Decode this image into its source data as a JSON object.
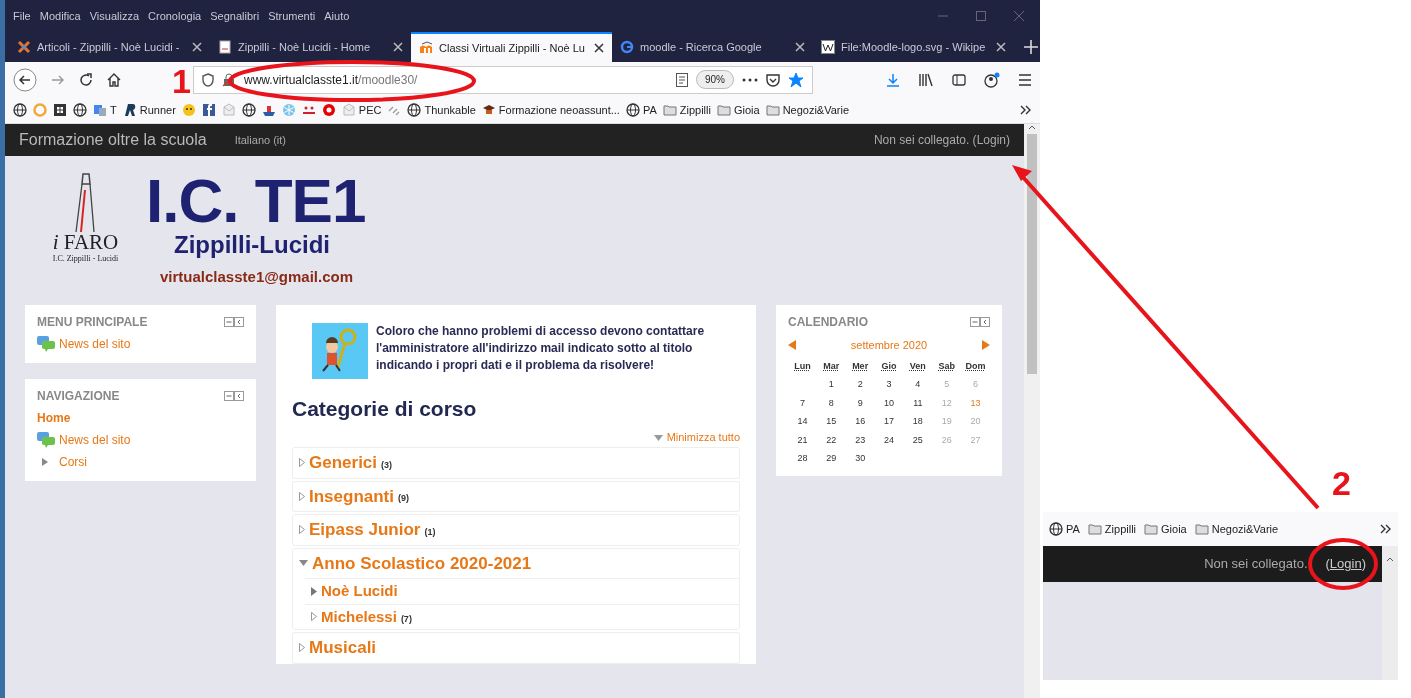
{
  "menu_bar": [
    "File",
    "Modifica",
    "Visualizza",
    "Cronologia",
    "Segnalibri",
    "Strumenti",
    "Aiuto"
  ],
  "tabs": [
    {
      "label": "Articoli - Zippilli - Noè Lucidi -",
      "kind": "joomla",
      "selected": false
    },
    {
      "label": "Zippilli - Noè Lucidi - Home",
      "kind": "page",
      "selected": false
    },
    {
      "label": "Classi Virtuali Zippilli - Noè Lu",
      "kind": "moodle",
      "selected": true
    },
    {
      "label": "moodle - Ricerca Google",
      "kind": "google",
      "selected": false
    },
    {
      "label": "File:Moodle-logo.svg - Wikipe",
      "kind": "wiki",
      "selected": false
    }
  ],
  "address_bar": {
    "host": "www.virtualclasste1.it",
    "path": "/moodle30/",
    "zoom": "90%",
    "bookmarked": true
  },
  "bookmarks": [
    {
      "kind": "globe"
    },
    {
      "kind": "ring"
    },
    {
      "kind": "grid"
    },
    {
      "kind": "globe"
    },
    {
      "kind": "translate",
      "label": "T"
    },
    {
      "kind": "r-logo",
      "label": "Runner"
    },
    {
      "kind": "smiley"
    },
    {
      "kind": "facebook"
    },
    {
      "kind": "mail"
    },
    {
      "kind": "globe"
    },
    {
      "kind": "ship"
    },
    {
      "kind": "snowflake"
    },
    {
      "kind": "iliad"
    },
    {
      "kind": "vodafone"
    },
    {
      "kind": "mail",
      "label": "PEC"
    },
    {
      "kind": "link"
    },
    {
      "kind": "globe",
      "label": "Thunkable"
    },
    {
      "kind": "cap",
      "label": "Formazione neoassunt..."
    },
    {
      "kind": "globe",
      "label": "PA"
    },
    {
      "kind": "folder",
      "label": "Zippilli"
    },
    {
      "kind": "folder",
      "label": "Gioia"
    },
    {
      "kind": "folder",
      "label": "Negozi&Varie"
    }
  ],
  "site_nav": {
    "brand": "Formazione oltre la scuola",
    "language": "Italiano (it)",
    "login_prefix": "Non sei collegato. (",
    "login_link": "Login",
    "login_suffix": ")"
  },
  "header": {
    "logo_initial": "i",
    "logo_word": "FARO",
    "logo_caption": "I.C. Zippilli - Lucidi",
    "title": "I.C. TE1",
    "subtitle": "Zippilli-Lucidi",
    "email": "virtualclasste1@gmail.com"
  },
  "left_blocks": [
    {
      "title": "MENU PRINCIPALE",
      "items": [
        {
          "label": "News del sito",
          "kind": "news"
        }
      ]
    },
    {
      "title": "NAVIGAZIONE",
      "items": [
        {
          "label": "Home",
          "kind": "current"
        },
        {
          "label": "News del sito",
          "kind": "news"
        },
        {
          "label": "Corsi",
          "kind": "branch"
        }
      ]
    }
  ],
  "notice": "Coloro che hanno problemi di accesso devono contattare l'amministratore all'indirizzo mail indicato sotto al titolo indicando i propri dati e il problema da risolvere!",
  "categories_heading": "Categorie di corso",
  "collapse_all": "Minimizza tutto",
  "categories": [
    {
      "name": "Generici",
      "count": "(3)",
      "expanded": false
    },
    {
      "name": "Insegnanti",
      "count": "(9)",
      "expanded": false
    },
    {
      "name": "Eipass Junior",
      "count": "(1)",
      "expanded": false
    },
    {
      "name": "Anno Scolastico 2020-2021",
      "expanded": true,
      "children": [
        {
          "name": "Noè Lucidi",
          "has_subcategories": true,
          "expanded": false
        },
        {
          "name": "Michelessi",
          "count": "(7)",
          "has_subcategories": false,
          "expanded": false
        }
      ]
    },
    {
      "name": "Musicali",
      "expanded": false
    }
  ],
  "calendar": {
    "title": "CALENDARIO",
    "month": "settembre 2020",
    "weekdays": [
      "Lun",
      "Mar",
      "Mer",
      "Gio",
      "Ven",
      "Sab",
      "Dom"
    ],
    "weeks": [
      [
        {
          "kind": "blank"
        },
        {
          "day": "1",
          "kind": "weekday"
        },
        {
          "day": "2",
          "kind": "weekday"
        },
        {
          "day": "3",
          "kind": "weekday"
        },
        {
          "day": "4",
          "kind": "weekday"
        },
        {
          "day": "5",
          "kind": "weekend"
        },
        {
          "day": "6",
          "kind": "weekend"
        }
      ],
      [
        {
          "day": "7",
          "kind": "weekday"
        },
        {
          "day": "8",
          "kind": "weekday"
        },
        {
          "day": "9",
          "kind": "weekday"
        },
        {
          "day": "10",
          "kind": "weekday"
        },
        {
          "day": "11",
          "kind": "weekday"
        },
        {
          "day": "12",
          "kind": "weekend"
        },
        {
          "day": "13",
          "kind": "today"
        }
      ],
      [
        {
          "day": "14",
          "kind": "weekday"
        },
        {
          "day": "15",
          "kind": "weekday"
        },
        {
          "day": "16",
          "kind": "weekday"
        },
        {
          "day": "17",
          "kind": "weekday"
        },
        {
          "day": "18",
          "kind": "weekday"
        },
        {
          "day": "19",
          "kind": "weekend"
        },
        {
          "day": "20",
          "kind": "weekend"
        }
      ],
      [
        {
          "day": "21",
          "kind": "weekday"
        },
        {
          "day": "22",
          "kind": "weekday"
        },
        {
          "day": "23",
          "kind": "weekday"
        },
        {
          "day": "24",
          "kind": "weekday"
        },
        {
          "day": "25",
          "kind": "weekday"
        },
        {
          "day": "26",
          "kind": "weekend"
        },
        {
          "day": "27",
          "kind": "weekend"
        }
      ],
      [
        {
          "day": "28",
          "kind": "weekday"
        },
        {
          "day": "29",
          "kind": "weekday"
        },
        {
          "day": "30",
          "kind": "weekday"
        }
      ]
    ]
  },
  "inset": {
    "bookmarks": [
      {
        "kind": "globe",
        "label": "PA"
      },
      {
        "kind": "folder",
        "label": "Zippilli"
      },
      {
        "kind": "folder",
        "label": "Gioia"
      },
      {
        "kind": "folder",
        "label": "Negozi&Varie"
      }
    ],
    "login_text": "Non sei collegato.",
    "login_open": "(",
    "login_link": "Login",
    "login_close": ")"
  },
  "callouts": [
    "1",
    "2"
  ]
}
